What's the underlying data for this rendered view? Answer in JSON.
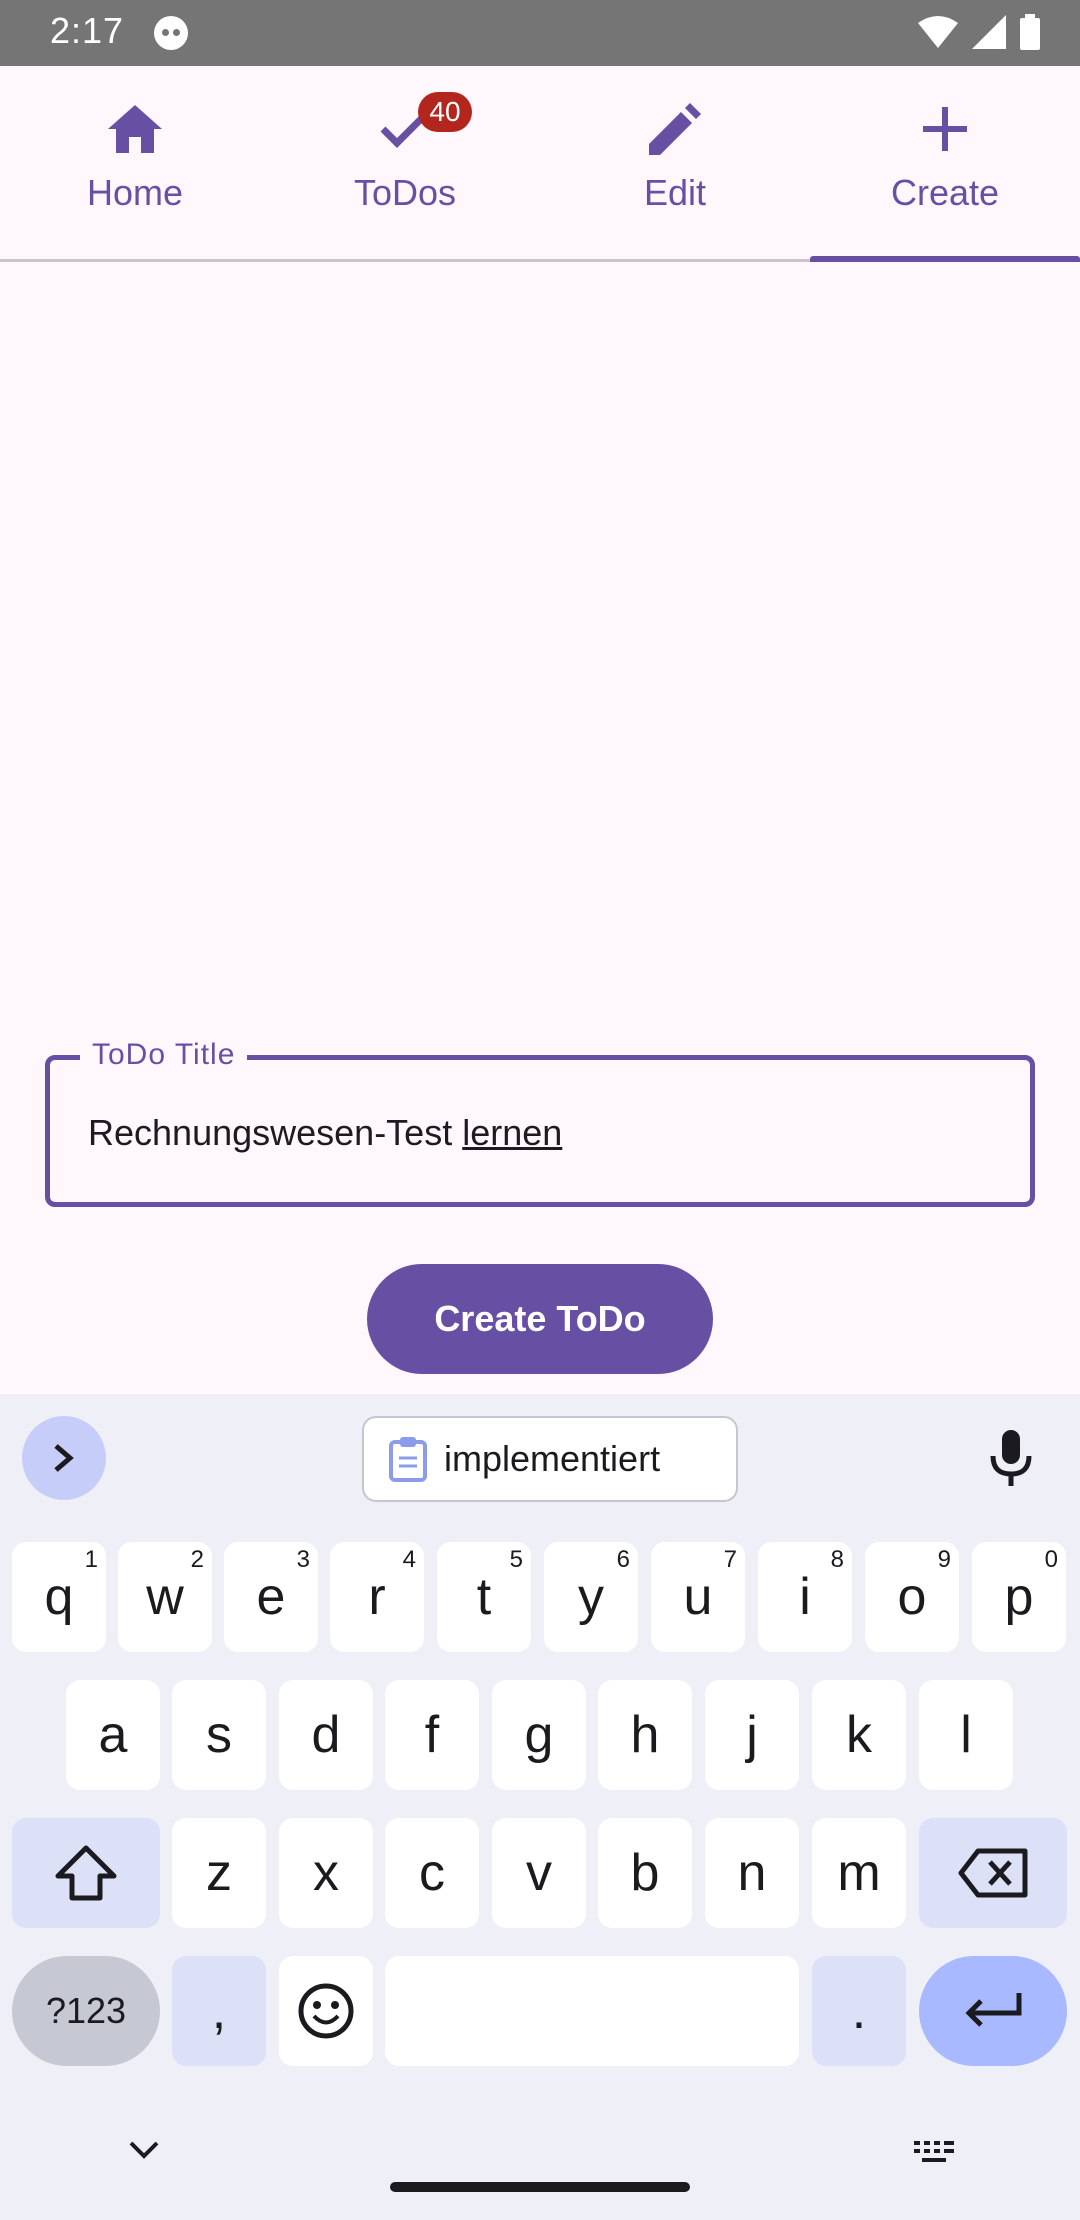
{
  "status_bar": {
    "time": "2:17"
  },
  "tabs": [
    {
      "label": "Home",
      "icon": "home-icon"
    },
    {
      "label": "ToDos",
      "icon": "check-icon",
      "badge": "40"
    },
    {
      "label": "Edit",
      "icon": "pencil-icon"
    },
    {
      "label": "Create",
      "icon": "plus-icon"
    }
  ],
  "selected_tab": "Create",
  "form": {
    "field_label": "ToDo Title",
    "field_value_main": "Rechnungswesen-Test ",
    "field_value_composing": "lernen",
    "submit_label": "Create ToDo"
  },
  "keyboard": {
    "suggestion": "implementiert",
    "row1": [
      {
        "k": "q",
        "h": "1"
      },
      {
        "k": "w",
        "h": "2"
      },
      {
        "k": "e",
        "h": "3"
      },
      {
        "k": "r",
        "h": "4"
      },
      {
        "k": "t",
        "h": "5"
      },
      {
        "k": "y",
        "h": "6"
      },
      {
        "k": "u",
        "h": "7"
      },
      {
        "k": "i",
        "h": "8"
      },
      {
        "k": "o",
        "h": "9"
      },
      {
        "k": "p",
        "h": "0"
      }
    ],
    "row2": [
      "a",
      "s",
      "d",
      "f",
      "g",
      "h",
      "j",
      "k",
      "l"
    ],
    "row3": [
      "z",
      "x",
      "c",
      "v",
      "b",
      "n",
      "m"
    ],
    "num_key": "?123",
    "comma_key": ",",
    "period_key": "."
  },
  "colors": {
    "primary": "#6750a4",
    "badge": "#b3261e",
    "background": "#fef7fc"
  }
}
